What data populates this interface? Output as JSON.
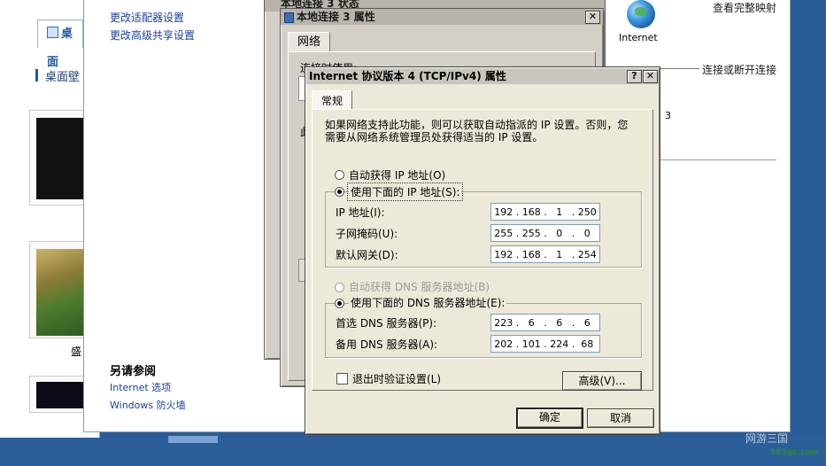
{
  "background_window": {
    "tab_label": "桌面",
    "section_label": "桌面壁",
    "thumb_caption": "盛"
  },
  "network_center": {
    "left_links": [
      "更改适配器设置",
      "更改高级共享设置"
    ],
    "see_also_title": "另请参阅",
    "see_also_links": [
      "Internet 选项",
      "Windows 防火墙"
    ],
    "top_right_link": "查看完整映射",
    "internet_label": "Internet",
    "connect_link": "连接或断开连接",
    "number_label": "3"
  },
  "dialog_status": {
    "title": "本地连接 3 状态"
  },
  "dialog_properties": {
    "title": "本地连接 3 属性",
    "tab_label": "网络",
    "connect_using_label": "连接时使用:",
    "item_hint": "此"
  },
  "ipv4_dialog": {
    "title": "Internet 协议版本 4 (TCP/IPv4) 属性",
    "help_button": "?",
    "close_button": "✕",
    "tab_label": "常规",
    "intro_text": "如果网络支持此功能，则可以获取自动指派的 IP 设置。否则，您需要从网络系统管理员处获得适当的 IP 设置。",
    "auto_ip_label": "自动获得 IP 地址(O)",
    "manual_ip_label": "使用下面的 IP 地址(S):",
    "ip_label": "IP 地址(I):",
    "ip_value": [
      "192",
      "168",
      "1",
      "250"
    ],
    "mask_label": "子网掩码(U):",
    "mask_value": [
      "255",
      "255",
      "0",
      "0"
    ],
    "gateway_label": "默认网关(D):",
    "gateway_value": [
      "192",
      "168",
      "1",
      "254"
    ],
    "auto_dns_label": "自动获得 DNS 服务器地址(B)",
    "manual_dns_label": "使用下面的 DNS 服务器地址(E):",
    "preferred_dns_label": "首选 DNS 服务器(P):",
    "preferred_dns_value": [
      "223",
      "6",
      "6",
      "6"
    ],
    "alternate_dns_label": "备用 DNS 服务器(A):",
    "alternate_dns_value": [
      "202",
      "101",
      "224",
      "68"
    ],
    "validate_label": "退出时验证设置(L)",
    "advanced_button": "高级(V)...",
    "ok_button": "确定",
    "cancel_button": "取消"
  },
  "watermark": {
    "brand": "网游三国",
    "url": "583gc.com"
  }
}
